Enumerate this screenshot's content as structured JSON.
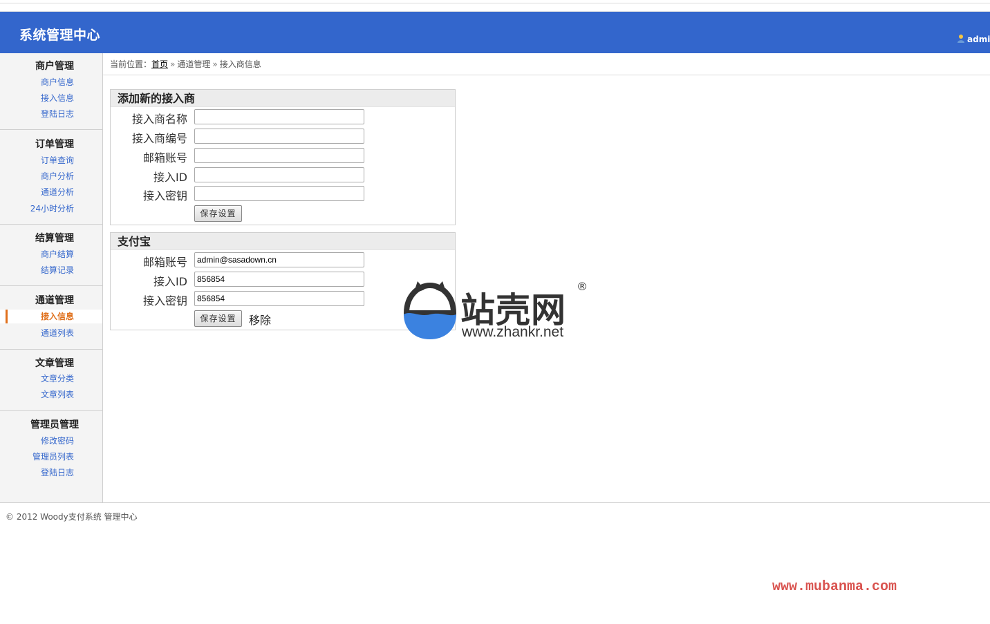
{
  "header": {
    "title": "系统管理中心",
    "user": "admi"
  },
  "sidebar": {
    "groups": [
      {
        "title": "商户管理",
        "items": [
          "商户信息",
          "接入信息",
          "登陆日志"
        ]
      },
      {
        "title": "订单管理",
        "items": [
          "订单查询",
          "商户分析",
          "通道分析",
          "24小时分析"
        ]
      },
      {
        "title": "结算管理",
        "items": [
          "商户结算",
          "结算记录"
        ]
      },
      {
        "title": "通道管理",
        "items": [
          "接入信息",
          "通道列表"
        ],
        "active_item": "接入信息"
      },
      {
        "title": "文章管理",
        "items": [
          "文章分类",
          "文章列表"
        ]
      },
      {
        "title": "管理员管理",
        "items": [
          "修改密码",
          "管理员列表",
          "登陆日志"
        ]
      }
    ]
  },
  "breadcrumb": {
    "prefix": "当前位置：",
    "home": "首页",
    "sep": "»",
    "level1": "通道管理",
    "level2": "接入商信息"
  },
  "add_panel": {
    "title": "添加新的接入商",
    "fields": [
      {
        "label": "接入商名称",
        "value": ""
      },
      {
        "label": "接入商编号",
        "value": ""
      },
      {
        "label": "邮箱账号",
        "value": ""
      },
      {
        "label": "接入ID",
        "value": ""
      },
      {
        "label": "接入密钥",
        "value": ""
      }
    ],
    "save_label": "保存设置"
  },
  "alipay_panel": {
    "title": "支付宝",
    "fields": [
      {
        "label": "邮箱账号",
        "value": "admin@sasadown.cn"
      },
      {
        "label": "接入ID",
        "value": "856854"
      },
      {
        "label": "接入密钥",
        "value": "856854"
      }
    ],
    "save_label": "保存设置",
    "remove_label": "移除"
  },
  "footer": {
    "copyright": "© 2012 Woody支付系统 管理中心"
  },
  "watermark": {
    "brand": "站壳网",
    "registered": "®",
    "url": "www.zhankr.net",
    "corner_url": "www.mubanma.com"
  },
  "colors": {
    "header_bg": "#3366cc",
    "link": "#3366cc",
    "active": "#e0701c",
    "watermark_red": "#d9534f"
  }
}
